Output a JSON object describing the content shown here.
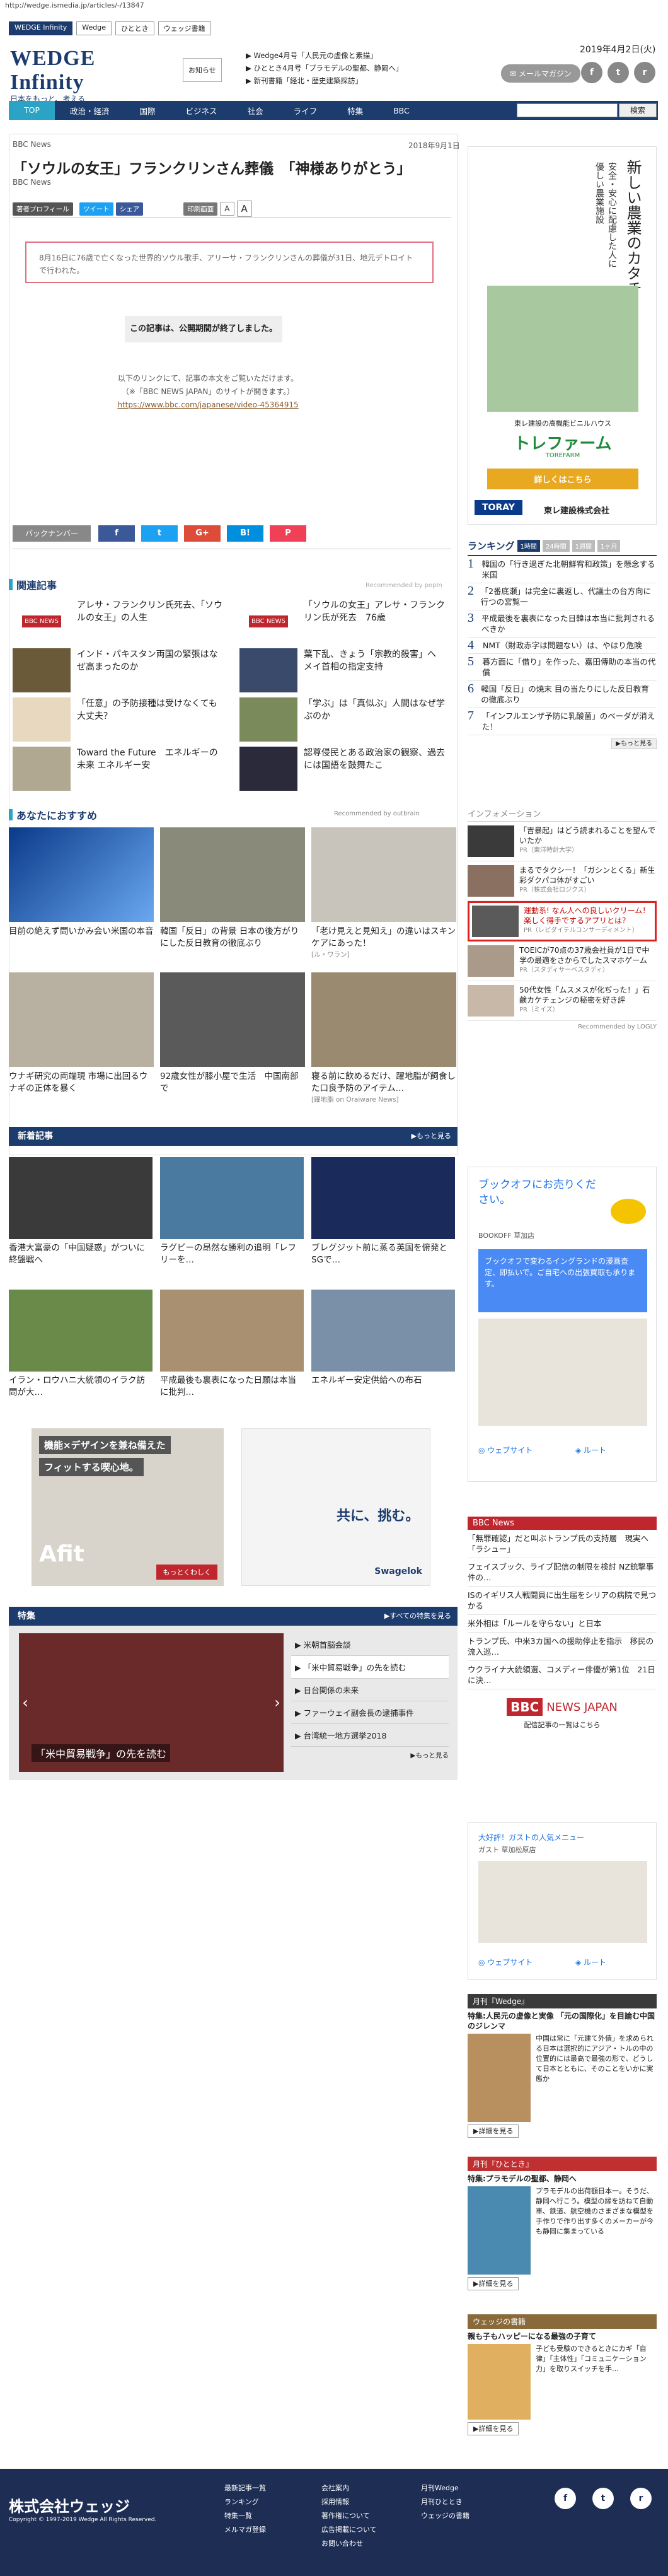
{
  "browser": {
    "url": "http://wedge.ismedia.jp/articles/-/13847"
  },
  "topnav": [
    {
      "label": "WEDGE Infinity",
      "active": true
    },
    {
      "label": "Wedge",
      "active": false
    },
    {
      "label": "ひととき",
      "active": false
    },
    {
      "label": "ウェッジ書籍",
      "active": false
    }
  ],
  "header": {
    "logo": "WEDGE Infinity",
    "tagline": "日本をもっと、考える",
    "notice_label": "お知らせ",
    "notices": [
      "Wedge4月号「人民元の虚像と素描」",
      "ひととき4月号「プラモデルの聖都、静岡へ」",
      "新刊書籍「経北・歴史建築探訪」"
    ],
    "date": "2019年4月2日(火)",
    "mail_button": "メールマガジン",
    "social": [
      "f",
      "t",
      "r"
    ]
  },
  "nav": {
    "items": [
      "TOP",
      "政治・経済",
      "国際",
      "ビジネス",
      "社会",
      "ライフ",
      "特集",
      "BBC"
    ],
    "active": "TOP",
    "search_button": "検索"
  },
  "article": {
    "source": "BBC News",
    "published": "2018年9月1日",
    "title": "「ソウルの女王」フランクリンさん葬儀　「神様ありがとう」",
    "author": "BBC News",
    "toolbar": {
      "profile": "著者プロフィール",
      "tweet": "ツイート",
      "share": "シェア",
      "print": "印刷画面",
      "font_a1": "A",
      "font_a2": "A"
    },
    "summary": "8月16日に76歳で亡くなった世界的ソウル歌手、アリーサ・フランクリンさんの葬儀が31日、地元デトロイトで行われた。",
    "expired": "この記事は、公開期間が終了しました。",
    "link_intro": "以下のリンクにて、記事の本文をご覧いただけます。",
    "link_note": "（※「BBC NEWS JAPAN」のサイトが開きます。）",
    "link_url": "https://www.bbc.com/japanese/video-45364915",
    "back_number": "バックナンバー",
    "share_buttons": [
      "f",
      "t",
      "G+",
      "B!",
      "P"
    ]
  },
  "related": {
    "heading": "関連記事",
    "recommended_by": "Recommended by popIn",
    "items": [
      {
        "title": "アレサ・フランクリン氏死去、「ソウルの女王」の人生",
        "thumb_label": "BBC NEWS"
      },
      {
        "title": "「ソウルの女王」アレサ・フランクリン氏が死去　76歳",
        "thumb_label": "BBC NEWS"
      },
      {
        "title": "インド・パキスタン両国の緊張はなぜ高まったのか",
        "thumb_label": ""
      },
      {
        "title": "葉下乱、きょう「宗教的殺害」へ　メイ首相の指定支持",
        "thumb_label": ""
      },
      {
        "title": "「任意」の予防接種は受けなくても大丈夫？",
        "thumb_label": ""
      },
      {
        "title": "「学ぶ」は「真似ぶ」人間はなぜ学ぶのか",
        "thumb_label": ""
      },
      {
        "title": "Toward the Future　エネルギーの未来 エネルギー安",
        "thumb_label": ""
      },
      {
        "title": "認尊侵民とある政治家の観察、過去には国語を鼓舞たこ",
        "thumb_label": ""
      }
    ]
  },
  "recommend": {
    "heading": "あなたにおすすめ",
    "recommended_by": "Recommended by outbrain",
    "items": [
      {
        "title": "目前の絶えず問いかみ会い米国の本音",
        "sponsor": ""
      },
      {
        "title": "韓国「反日」の背景 日本の後方がりにした反日教育の徹底ぶり",
        "sponsor": ""
      },
      {
        "title": "「老け見えと見知え」の違いはスキンケアにあった！",
        "sponsor": "[ル・ワラン]"
      },
      {
        "title": "ウナギ研究の両端現 市場に出回るウナギの正体を暴く",
        "sponsor": ""
      },
      {
        "title": "92歳女性が膝小屋で生活　中国南部で",
        "sponsor": ""
      },
      {
        "title": "寝る前に飲めるだけ、躍地脂が飼食した口良予防のアイテム…",
        "sponsor": "[躍地脂 on Oraiware News]"
      }
    ]
  },
  "new_articles": {
    "heading": "新着記事",
    "more": "▶もっと見る",
    "items": [
      "香港大富豪の「中国疑惑」がついに終盤戦へ",
      "ラグビーの昂然な勝利の追明「レフリーを…",
      "ブレグジット前に蒸る英国を俯発とSGで…",
      "イラン・ロウハニ大統領のイラク訪問が大…",
      "平成最後も裏表になった日願は本当に批判…",
      "エネルギー安定供給への布石"
    ]
  },
  "ads": {
    "afit_line1": "機能×デザインを兼ね備えた",
    "afit_line2": "フィットする喫心地。",
    "afit_brand": "Afit",
    "afit_cta": "もっとくわしく",
    "swagelok_line": "共に、挑む。",
    "swagelok_brand": "Swagelok"
  },
  "special": {
    "heading": "特集",
    "more": "▶すべての特集を見る",
    "caption": "「米中貿易戦争」の先を読む",
    "items": [
      "米朝首脳会談",
      "「米中貿易戦争」の先を読む",
      "日台関係の未来",
      "ファーウェイ副会長の逮捕事件",
      "台湾統一地方選挙2018"
    ],
    "more2": "▶もっと見る"
  },
  "sidebar_ad": {
    "headline": "新しい農業のカタチ",
    "sub": "安全・安心に配慮した人に優しい農業施設",
    "desc": "東レ建設の高機能ビニルハウス",
    "brand": "トレファーム",
    "brand_en": "TOREFARM",
    "cta": "詳しくはこちら",
    "company1": "TORAY",
    "company2": "東レ建設株式会社"
  },
  "ranking": {
    "heading": "ランキング",
    "tabs": [
      "1時間",
      "24時間",
      "1週間",
      "1ヶ月"
    ],
    "items": [
      "韓国の「行き過ぎた北朝鮮宥和政策」を懸念する米国",
      "「2番底瀬」は完全に裏返し、代議士の台方向に行つの宮覧一",
      "平成最後を裏表になった日韓は本当に批判されるべきか",
      "NMT（財政赤字は問題ない）は、やはり危険",
      "暮方面に「借り」を作った、嘉田傳助の本当の代償",
      "韓国「反日」の焼末 目の当たりにした反日教育の徹底ぶり",
      "「インフルエンザ予防に乳酸菌」のベーダが消えた！"
    ],
    "more": "▶もっと見る"
  },
  "infomation": {
    "heading": "インフォメーション",
    "items": [
      {
        "title": "「吉暴起」はどう読まれることを望んでいたか",
        "pr": "PR（東洋時計大学）"
      },
      {
        "title": "まるでタクシー！「ガシンとくる」新生彩ダクパコ体がすごい",
        "pr": "PR（株式会社ロジクス）"
      },
      {
        "title": "運動系! なん人への良しいクリーム！楽しく得手でするアプリとは？",
        "pr": "PR（レピダイテルコンサーディメント）"
      },
      {
        "title": "TOEICが70点の37歳会社員が1日で中学の最適をさからでしたスマホゲーム",
        "pr": "PR（スタディサーベスタディ）"
      },
      {
        "title": "50代女性「ムスメスが化ぢった！」石鹸カケチェンジの秘密を好き評",
        "pr": "PR（ミイズ）"
      }
    ],
    "recommended_by": "Recommended by LOGLY"
  },
  "map_ad": {
    "q": "ブックオフにお売りください。",
    "store": "BOOKOFF 草加店",
    "store_desc": "ブックオフで変わるイングランドの漫画査定、即払いで。ご自宅への出張買取も承ります。",
    "website": "ウェブサイト",
    "route": "ルート"
  },
  "bbc": {
    "heading": "BBC News",
    "items": [
      "「無罪確認」だと叫ぶトランプ氏の支持層　現実へ「ラシュー」",
      "フェイスブック、ライブ配信の制限を検討 NZ銃撃事件の…",
      "ISのイギリス人戦闘員に出生届をシリアの病院で見つかる",
      "米外相は「ルールを守らない」と日本",
      "トランプ氏、中米3カ国への援助停止を指示　移民の流入巡…",
      "ウクライナ大統領選、コメディー俳優が第1位　21日に決…"
    ],
    "logo_main": "BBC",
    "logo_sub": "NEWS JAPAN",
    "link": "配信記事の一覧はこちら"
  },
  "map_ad2": {
    "q": "大好評！ガストの人気メニュー",
    "store": "ガスト 草加松原店",
    "website": "ウェブサイト",
    "route": "ルート"
  },
  "magazines": [
    {
      "header": "月刊『Wedge』",
      "title": "特集:人民元の虚像と実像 「元の国際化」を目論む中国のジレンマ",
      "body": "中国は常に「元建て外債」を求められる日本は選択的にアジア・トルの中の位置的には最高で最強の形で、どうして日本とともに、そのことをいかに実態か",
      "btn": "▶詳細を見る",
      "color": "#3a3a3a"
    },
    {
      "header": "月刊『ひととき』",
      "title": "特集:プラモデルの聖都、静岡へ",
      "body": "プラモデルの出荷額日本一。そうだ、静岡へ行こう。模型の縁を訪ねて自動車、鉄道、航空機のさまざまな模型を手作りで作り出す多くのメーカーが今も静岡に集まっている",
      "btn": "▶詳細を見る",
      "color": "#c03030"
    },
    {
      "header": "ウェッジの書籍",
      "title": "親も子もハッピーになる最強の子育て",
      "body": "子ども受験のできるときにカギ「自律」「主体性」「コミュニケーション力」を取りスイッチを手…",
      "btn": "▶詳細を見る",
      "color": "#8a6a3a"
    }
  ],
  "footer": {
    "company": "株式会社ウェッジ",
    "copyright": "Copyright © 1997-2019 Wedge All Rights Reserved.",
    "col1": [
      "最新記事一覧",
      "ランキング",
      "特集一覧",
      "メルマガ登録"
    ],
    "col2": [
      "会社案内",
      "採用情報",
      "著作権について",
      "広告掲載について",
      "お問い合わせ"
    ],
    "col3": [
      "月刊Wedge",
      "月刊ひととき",
      "ウェッジの書籍"
    ],
    "social": [
      "f",
      "t",
      "r"
    ]
  },
  "colors": {
    "navy": "#1d3c6e",
    "accent": "#2aa3c4",
    "ad_green": "#1f8a3a",
    "bbc_red": "#c0262e"
  }
}
